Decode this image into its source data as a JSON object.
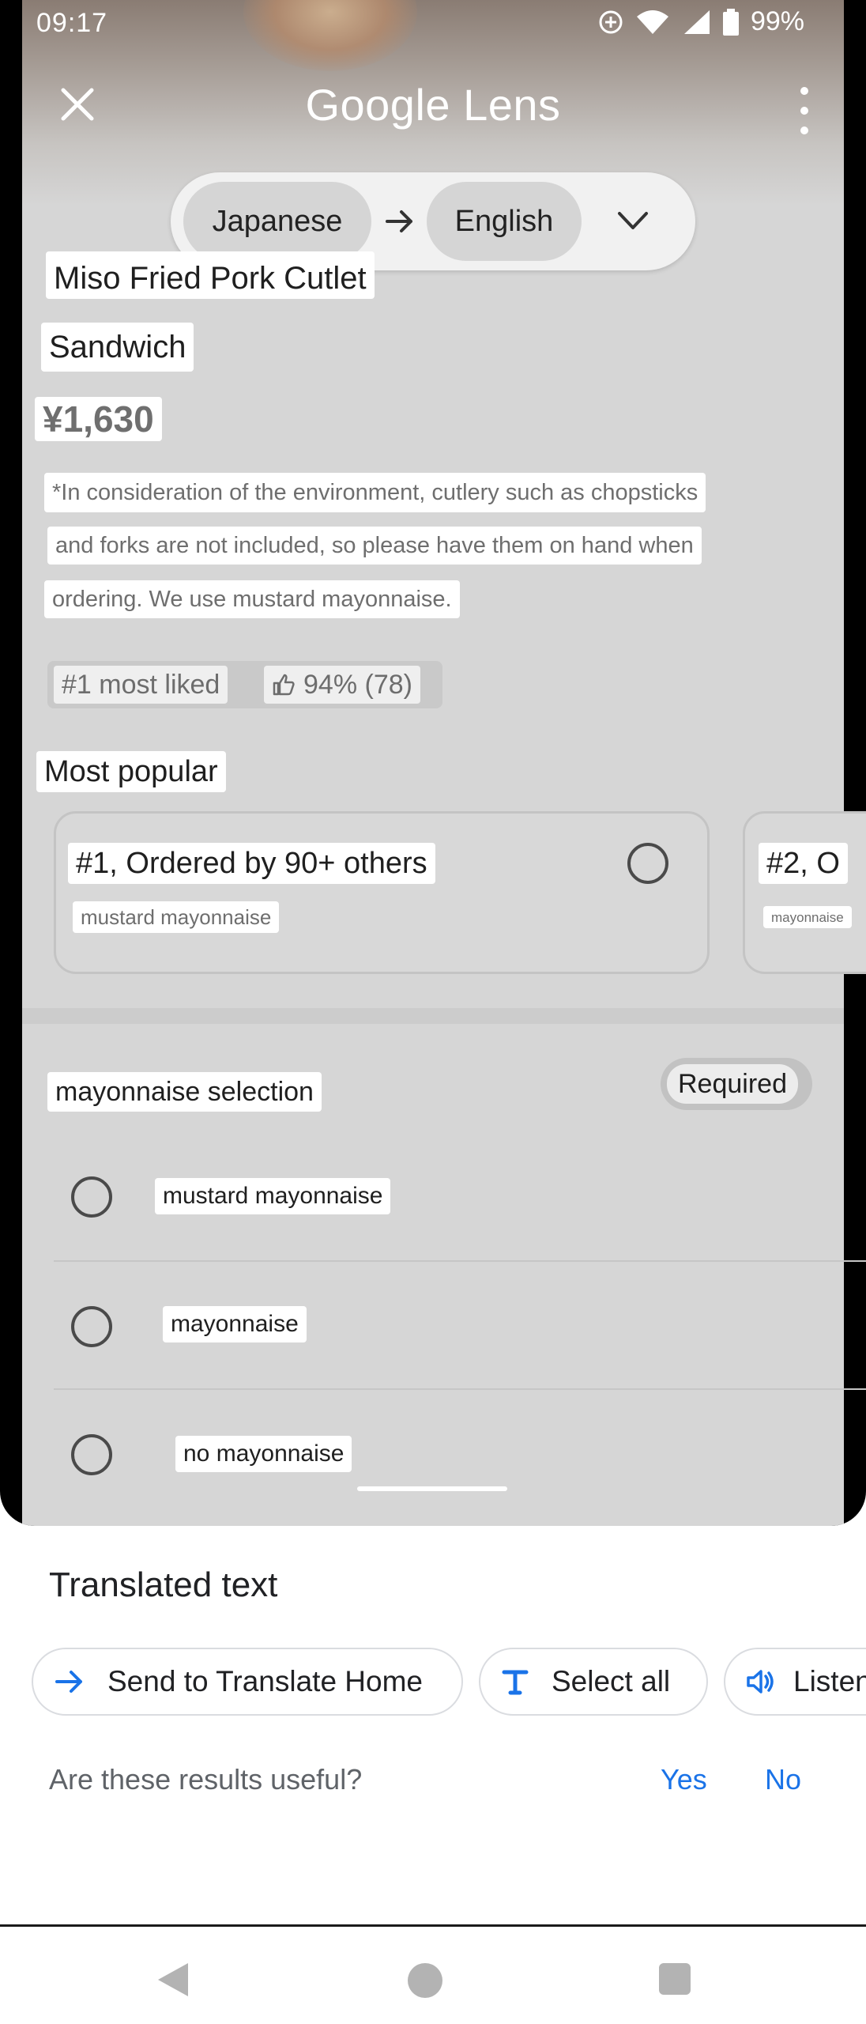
{
  "status_bar": {
    "time": "09:17",
    "battery": "99%"
  },
  "lens": {
    "title": "Google Lens",
    "source_language": "Japanese",
    "target_language": "English"
  },
  "item": {
    "title_line1": "Miso Fried Pork Cutlet",
    "title_line2": "Sandwich",
    "price": "¥1,630",
    "description": [
      "*In consideration of the environment, cutlery such as chopsticks",
      "and forks are not included, so please have them on hand when",
      "ordering. We use mustard mayonnaise."
    ],
    "rank": "#1 most liked",
    "likes": "94% (78)"
  },
  "most_popular": {
    "heading": "Most popular",
    "cards": [
      {
        "title": "#1, Ordered by 90+ others",
        "subtitle": "mustard mayonnaise"
      },
      {
        "title": "#2, O",
        "subtitle": "mayonnaise"
      }
    ]
  },
  "mayonnaise_section": {
    "heading": "mayonnaise selection",
    "badge": "Required",
    "options": [
      "mustard mayonnaise",
      "mayonnaise",
      "no mayonnaise"
    ]
  },
  "sheet": {
    "title": "Translated text",
    "actions": {
      "send": "Send to Translate Home",
      "select_all": "Select all",
      "listen": "Listen"
    },
    "feedback": {
      "question": "Are these results useful?",
      "yes": "Yes",
      "no": "No"
    }
  },
  "colors": {
    "accent": "#1a73e8",
    "overlay_bg": "#d6d6d6",
    "chip_bg": "#ffffff"
  }
}
